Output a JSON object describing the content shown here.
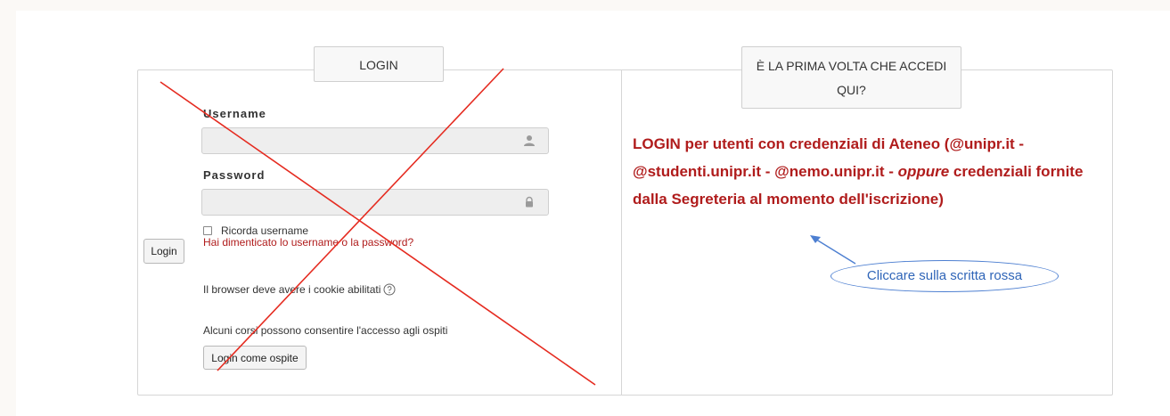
{
  "tabs": {
    "login": "LOGIN",
    "first_time_line1": "È LA PRIMA VOLTA CHE ACCEDI",
    "first_time_line2": "QUI?"
  },
  "login_form": {
    "username_label": "Username",
    "password_label": "Password",
    "username_value": "",
    "password_value": "",
    "remember_label": "Ricorda username",
    "forgot_link": "Hai dimenticato lo username o la password?",
    "login_button": "Login",
    "cookie_note": "Il browser deve avere i cookie abilitati",
    "guest_note": "Alcuni corsi possono consentire l'accesso agli ospiti",
    "guest_button": "Login come ospite"
  },
  "ateneo": {
    "part1": "LOGIN per utenti con credenziali di Ateneo (@unipr.it - @studenti.unipr.it - @nemo.unipr.it - ",
    "part2": "oppure",
    "part3": " credenziali fornite dalla Segreteria al momento dell'iscrizione)"
  },
  "annotation": {
    "callout_text": "Cliccare sulla scritta rossa"
  },
  "colors": {
    "link_red": "#b01c1c",
    "annotation_blue": "#4d7fd1",
    "cross_red": "#e52b20"
  },
  "icons": [
    "user-icon",
    "lock-icon",
    "help-circle-icon"
  ]
}
